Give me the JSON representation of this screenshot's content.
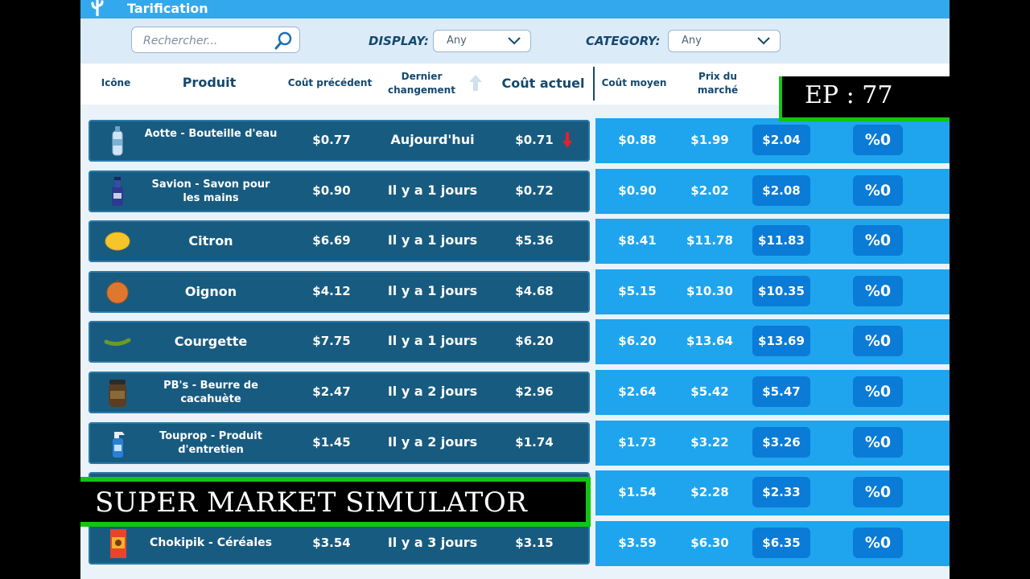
{
  "titlebar": {
    "title": "Tarification"
  },
  "filters": {
    "search_placeholder": "Rechercher...",
    "display_label": "DISPLAY:",
    "display_value": "Any",
    "category_label": "CATEGORY:",
    "category_value": "Any"
  },
  "header": {
    "icon": "Icône",
    "product": "Produit",
    "prev_cost": "Coût précédent",
    "last_change": "Dernier changement",
    "current_cost": "Coût actuel",
    "avg_cost": "Coût moyen",
    "market_price_1": "Prix du",
    "market_price_2": "marché"
  },
  "rows": [
    {
      "icon": "water-bottle-icon",
      "name": "Aotte - Bouteille d'eau",
      "prev": "$0.77",
      "changed": "Aujourd'hui",
      "current": "$0.71",
      "trend": "down",
      "avg": "$0.88",
      "market": "$1.99",
      "price": "$2.04",
      "pct": "%0"
    },
    {
      "icon": "soap-bottle-icon",
      "name": "Savion - Savon pour les mains",
      "prev": "$0.90",
      "changed": "Il y a 1 jours",
      "current": "$0.72",
      "trend": "",
      "avg": "$0.90",
      "market": "$2.02",
      "price": "$2.08",
      "pct": "%0"
    },
    {
      "icon": "lemon-icon",
      "name": "Citron",
      "prev": "$6.69",
      "changed": "Il y a 1 jours",
      "current": "$5.36",
      "trend": "",
      "avg": "$8.41",
      "market": "$11.78",
      "price": "$11.83",
      "pct": "%0"
    },
    {
      "icon": "onion-icon",
      "name": "Oignon",
      "prev": "$4.12",
      "changed": "Il y a 1 jours",
      "current": "$4.68",
      "trend": "",
      "avg": "$5.15",
      "market": "$10.30",
      "price": "$10.35",
      "pct": "%0"
    },
    {
      "icon": "zucchini-icon",
      "name": "Courgette",
      "prev": "$7.75",
      "changed": "Il y a 1 jours",
      "current": "$6.20",
      "trend": "",
      "avg": "$6.20",
      "market": "$13.64",
      "price": "$13.69",
      "pct": "%0"
    },
    {
      "icon": "peanut-butter-jar-icon",
      "name": "PB's - Beurre de cacahuète",
      "prev": "$2.47",
      "changed": "Il y a 2 jours",
      "current": "$2.96",
      "trend": "",
      "avg": "$2.64",
      "market": "$5.42",
      "price": "$5.47",
      "pct": "%0"
    },
    {
      "icon": "spray-bottle-icon",
      "name": "Touprop - Produit d'entretien",
      "prev": "$1.45",
      "changed": "Il y a 2 jours",
      "current": "$1.74",
      "trend": "",
      "avg": "$1.73",
      "market": "$3.22",
      "price": "$3.26",
      "pct": "%0"
    },
    {
      "icon": "",
      "name": "",
      "prev": "",
      "changed": "",
      "current": "",
      "trend": "",
      "avg": "$1.54",
      "market": "$2.28",
      "price": "$2.33",
      "pct": "%0"
    },
    {
      "icon": "cereal-box-icon",
      "name": "Chokipik - Céréales",
      "prev": "$3.54",
      "changed": "Il y a 3 jours",
      "current": "$3.15",
      "trend": "",
      "avg": "$3.59",
      "market": "$6.30",
      "price": "$6.35",
      "pct": "%0"
    }
  ],
  "overlays": {
    "episode": "EP : 77",
    "series_title": "SUPER MARKET  SIMULATOR"
  },
  "colors": {
    "accent": "#34a8ec",
    "row_dark": "#185b80",
    "row_light": "#1ea5ee",
    "button": "#0a7bd6",
    "trend_down": "#e8202a",
    "overlay_border": "#11c511"
  }
}
